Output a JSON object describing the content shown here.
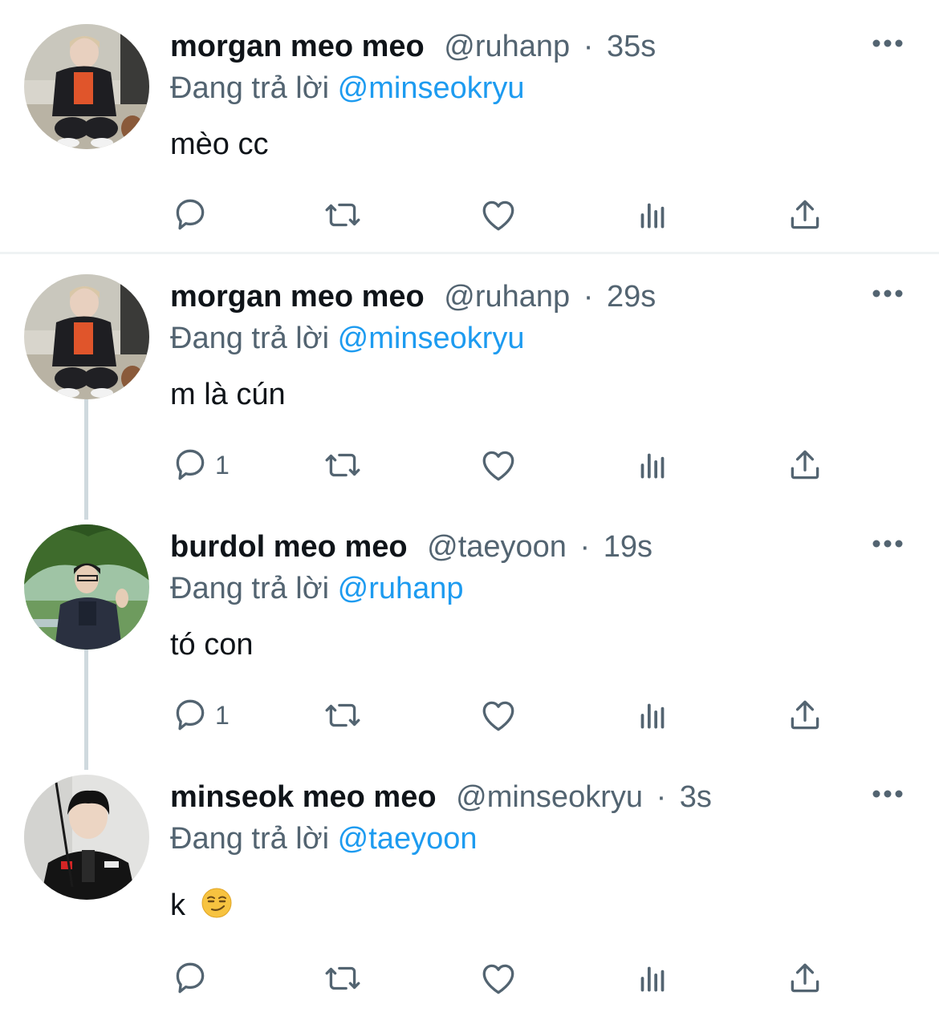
{
  "tweets": [
    {
      "name": "morgan meo meo",
      "handle": "@ruhanp",
      "time": "35s",
      "reply_prefix": "Đang trả lời",
      "reply_to": "@minseokryu",
      "text": "mèo cc",
      "reply_count": "",
      "avatar_icon": "avatar-morgan"
    },
    {
      "name": "morgan meo meo",
      "handle": "@ruhanp",
      "time": "29s",
      "reply_prefix": "Đang trả lời",
      "reply_to": "@minseokryu",
      "text": "m là cún",
      "reply_count": "1",
      "avatar_icon": "avatar-morgan"
    },
    {
      "name": "burdol meo meo",
      "handle": "@taeyoon",
      "time": "19s",
      "reply_prefix": "Đang trả lời",
      "reply_to": "@ruhanp",
      "text": "tó con",
      "reply_count": "1",
      "avatar_icon": "avatar-burdol"
    },
    {
      "name": "minseok meo meo",
      "handle": "@minseokryu",
      "time": "3s",
      "reply_prefix": "Đang trả lời",
      "reply_to": "@taeyoon",
      "text": "k",
      "emoji": "smirking-face",
      "reply_count": "",
      "avatar_icon": "avatar-minseok"
    }
  ],
  "separator": "·",
  "colors": {
    "link": "#1d9bf0",
    "secondary": "#536471",
    "primary": "#0f1419",
    "thread_line": "#cfd9de"
  }
}
